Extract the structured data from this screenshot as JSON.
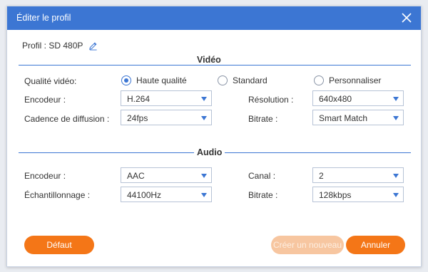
{
  "dialog": {
    "title": "Éditer le profil",
    "close_icon": "close-icon"
  },
  "profile": {
    "text": "Profil : SD 480P",
    "edit_icon": "pencil-icon"
  },
  "video": {
    "section_title": "Vidéo",
    "quality_label": "Qualité vidéo:",
    "quality_options": [
      "Haute qualité",
      "Standard",
      "Personnaliser"
    ],
    "quality_selected": "Haute qualité",
    "encoder_label": "Encodeur :",
    "encoder_value": "H.264",
    "framerate_label": "Cadence de diffusion :",
    "framerate_value": "24fps",
    "resolution_label": "Résolution :",
    "resolution_value": "640x480",
    "bitrate_label": "Bitrate :",
    "bitrate_value": "Smart Match"
  },
  "audio": {
    "section_title": "Audio",
    "encoder_label": "Encodeur :",
    "encoder_value": "AAC",
    "samplerate_label": "Échantillonnage :",
    "samplerate_value": "44100Hz",
    "channel_label": "Canal :",
    "channel_value": "2",
    "bitrate_label": "Bitrate :",
    "bitrate_value": "128kbps"
  },
  "footer": {
    "default_label": "Défaut",
    "create_new_label": "Créer un nouveau",
    "cancel_label": "Annuler"
  },
  "colors": {
    "accent": "#3c76d3",
    "button": "#f47617",
    "button_disabled": "#f7c6a0"
  }
}
